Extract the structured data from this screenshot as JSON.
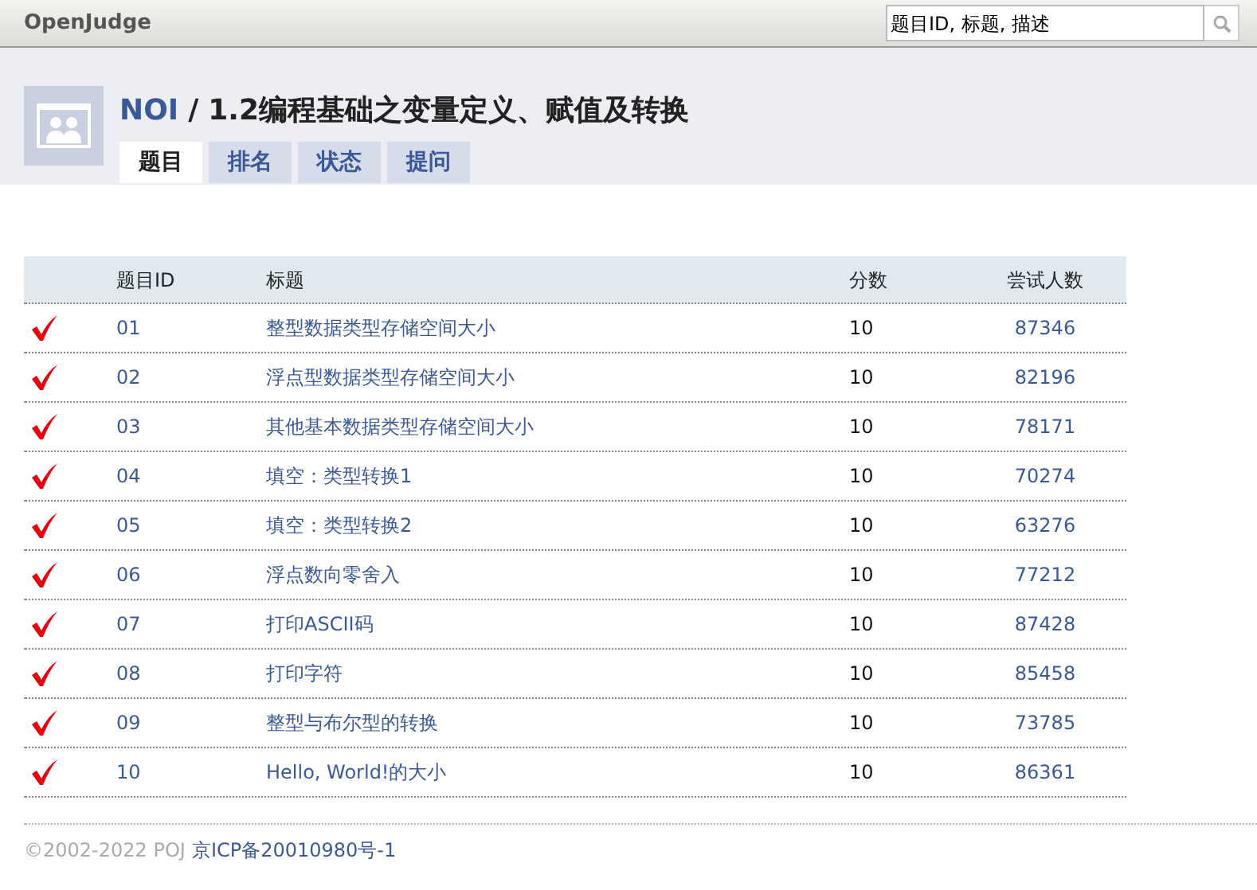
{
  "header": {
    "brand": "OpenJudge",
    "search": {
      "placeholder": "题目ID, 标题, 描述"
    }
  },
  "group": {
    "name": "NOI",
    "separator": "/",
    "title": "1.2编程基础之变量定义、赋值及转换"
  },
  "tabs": [
    {
      "label": "题目",
      "selected": true
    },
    {
      "label": "排名",
      "selected": false
    },
    {
      "label": "状态",
      "selected": false
    },
    {
      "label": "提问",
      "selected": false
    }
  ],
  "table": {
    "columns": [
      "题目ID",
      "标题",
      "分数",
      "尝试人数"
    ],
    "rows": [
      {
        "solved": true,
        "id": "01",
        "title": "整型数据类型存储空间大小",
        "score": "10",
        "attempts": "87346"
      },
      {
        "solved": true,
        "id": "02",
        "title": "浮点型数据类型存储空间大小",
        "score": "10",
        "attempts": "82196"
      },
      {
        "solved": true,
        "id": "03",
        "title": "其他基本数据类型存储空间大小",
        "score": "10",
        "attempts": "78171"
      },
      {
        "solved": true,
        "id": "04",
        "title": "填空：类型转换1",
        "score": "10",
        "attempts": "70274"
      },
      {
        "solved": true,
        "id": "05",
        "title": "填空：类型转换2",
        "score": "10",
        "attempts": "63276"
      },
      {
        "solved": true,
        "id": "06",
        "title": "浮点数向零舍入",
        "score": "10",
        "attempts": "77212"
      },
      {
        "solved": true,
        "id": "07",
        "title": "打印ASCII码",
        "score": "10",
        "attempts": "87428"
      },
      {
        "solved": true,
        "id": "08",
        "title": "打印字符",
        "score": "10",
        "attempts": "85458"
      },
      {
        "solved": true,
        "id": "09",
        "title": "整型与布尔型的转换",
        "score": "10",
        "attempts": "73785"
      },
      {
        "solved": true,
        "id": "10",
        "title": "Hello, World!的大小",
        "score": "10",
        "attempts": "86361"
      }
    ]
  },
  "footer": {
    "copyright": "©2002-2022 POJ",
    "icp": "京ICP备20010980号-1"
  }
}
